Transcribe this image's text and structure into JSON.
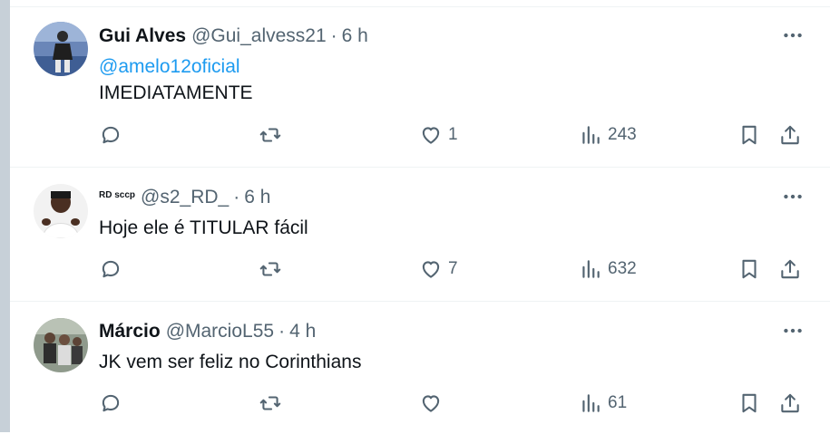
{
  "tweets": [
    {
      "name": "Gui Alves",
      "handle": "@Gui_alvess21",
      "separator": "·",
      "time": "6 h",
      "mention": "@amelo12oficial",
      "text": "IMEDIATAMENTE",
      "likes": "1",
      "views": "243"
    },
    {
      "name": "RD sccp",
      "handle": "@s2_RD_",
      "separator": "·",
      "time": "6 h",
      "text": "Hoje ele é TITULAR fácil",
      "likes": "7",
      "views": "632"
    },
    {
      "name": "Márcio",
      "handle": "@MarcioL55",
      "separator": "·",
      "time": "4 h",
      "text": "JK vem ser feliz no Corinthians",
      "likes": "",
      "views": "61"
    }
  ],
  "icons": {
    "reply": "reply-icon",
    "retweet": "retweet-icon",
    "like": "like-icon",
    "views": "views-icon",
    "bookmark": "bookmark-icon",
    "share": "share-icon",
    "more": "more-icon"
  },
  "colors": {
    "mention": "#1d9bf0",
    "secondary_text": "#536471",
    "divider": "#eff3f4"
  }
}
